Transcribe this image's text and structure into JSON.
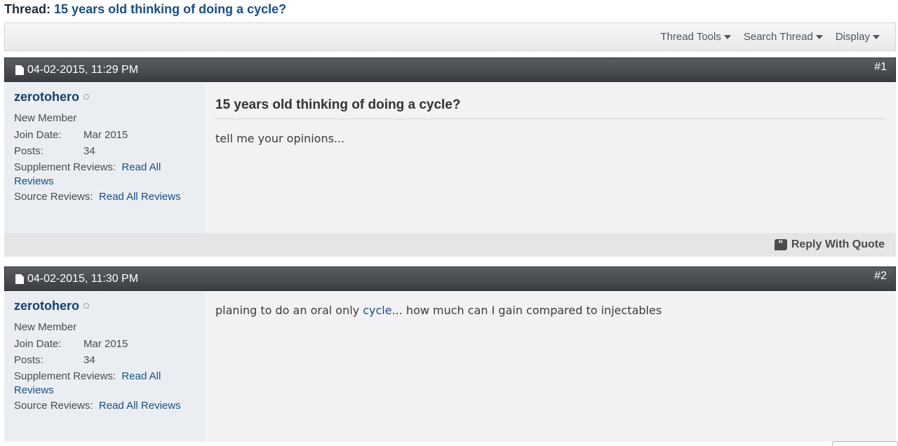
{
  "thread": {
    "prefix": "Thread:",
    "title": "15 years old thinking of doing a cycle?"
  },
  "toolbar": {
    "thread_tools": "Thread Tools",
    "search_thread": "Search Thread",
    "display": "Display"
  },
  "posts": [
    {
      "date": "04-02-2015, 11:29 PM",
      "number": "#1",
      "user": {
        "name": "zerotohero",
        "title": "New Member",
        "join_label": "Join Date:",
        "join_value": "Mar 2015",
        "posts_label": "Posts:",
        "posts_value": "34",
        "supp_label": "Supplement Reviews:",
        "supp_link_1": "Read All",
        "supp_link_2": "Reviews",
        "source_label": "Source Reviews:",
        "source_link": "Read All Reviews"
      },
      "title": "15 years old thinking of doing a cycle?",
      "text": "tell me your opinions...",
      "reply_label": "Reply With Quote"
    },
    {
      "date": "04-02-2015, 11:30 PM",
      "number": "#2",
      "user": {
        "name": "zerotohero",
        "title": "New Member",
        "join_label": "Join Date:",
        "join_value": "Mar 2015",
        "posts_label": "Posts:",
        "posts_value": "34",
        "supp_label": "Supplement Reviews:",
        "supp_link_1": "Read All",
        "supp_link_2": "Reviews",
        "source_label": "Source Reviews:",
        "source_link": "Read All Reviews"
      },
      "text_before": "planing to do an oral only ",
      "text_link": "cycle",
      "text_after": "... how much can I gain compared to injectables"
    }
  ]
}
